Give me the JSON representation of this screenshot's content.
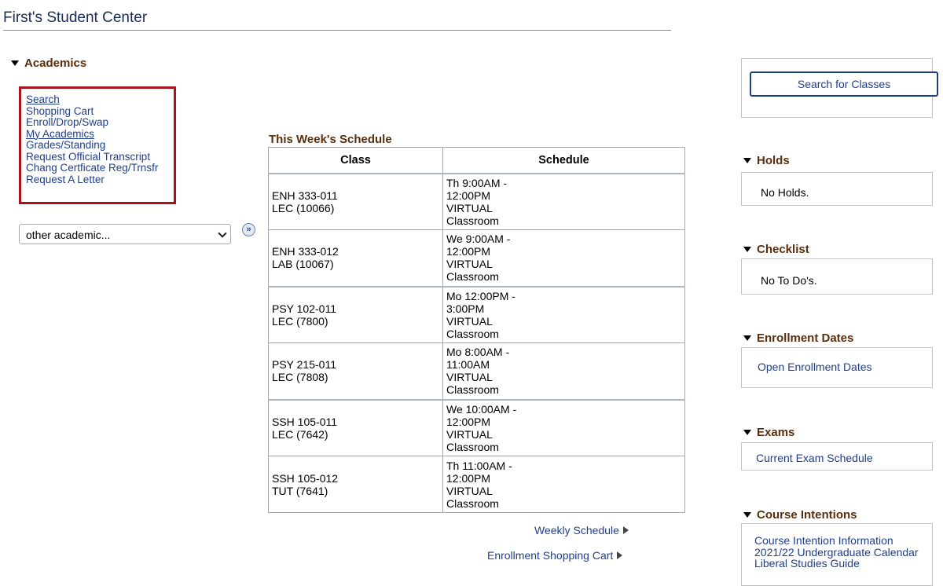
{
  "page": {
    "title": "First's Student Center"
  },
  "academics": {
    "heading": "Academics",
    "links": [
      "Search",
      "Shopping Cart",
      "Enroll/Drop/Swap",
      "My Academics",
      "Grades/Standing",
      "Request Official Transcript",
      "Chang Certficate Reg/Trnsfr",
      "Request A Letter"
    ],
    "select_value": "other academic..."
  },
  "schedule": {
    "title": "This Week's Schedule",
    "columns": [
      "Class",
      "Schedule"
    ],
    "rows": [
      {
        "class_line1": "ENH 333-011",
        "class_line2": "LEC (10066)",
        "schedule": "Th 9:00AM -\n12:00PM\nVIRTUAL\nClassroom"
      },
      {
        "class_line1": "ENH 333-012",
        "class_line2": "LAB (10067)",
        "schedule": "We 9:00AM -\n12:00PM\nVIRTUAL\nClassroom"
      },
      {
        "class_line1": "PSY 102-011",
        "class_line2": "LEC (7800)",
        "schedule": "Mo 12:00PM -\n3:00PM\nVIRTUAL\nClassroom"
      },
      {
        "class_line1": "PSY 215-011",
        "class_line2": "LEC (7808)",
        "schedule": "Mo 8:00AM -\n11:00AM\nVIRTUAL\nClassroom"
      },
      {
        "class_line1": "SSH 105-011",
        "class_line2": "LEC (7642)",
        "schedule": "We 10:00AM -\n12:00PM\nVIRTUAL\nClassroom"
      },
      {
        "class_line1": "SSH 105-012",
        "class_line2": "TUT (7641)",
        "schedule": "Th 11:00AM -\n12:00PM\nVIRTUAL\nClassroom"
      }
    ],
    "weekly_link": "Weekly Schedule",
    "cart_link": "Enrollment Shopping Cart"
  },
  "right": {
    "search_button": "Search for Classes",
    "holds": {
      "heading": "Holds",
      "text": "No Holds."
    },
    "checklist": {
      "heading": "Checklist",
      "text": "No To Do's."
    },
    "enrollment": {
      "heading": "Enrollment Dates",
      "link": "Open Enrollment Dates"
    },
    "exams": {
      "heading": "Exams",
      "link": "Current Exam Schedule"
    },
    "course_intentions": {
      "heading": "Course Intentions",
      "links": [
        "Course Intention Information",
        "2021/22 Undergraduate Calendar",
        "Liberal Studies Guide"
      ]
    }
  },
  "colors": {
    "section_heading": "#5a2e0c",
    "link": "#1f3e8c",
    "highlight_box": "#a8141b"
  }
}
